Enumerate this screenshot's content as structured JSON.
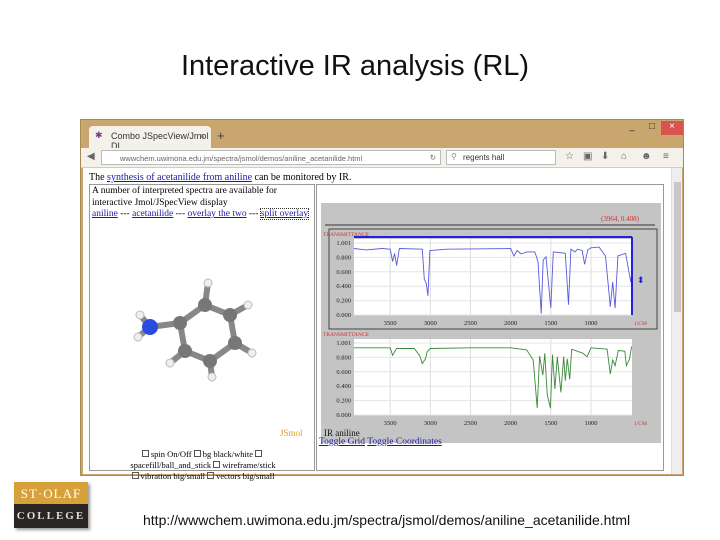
{
  "slide": {
    "title": "Interactive IR analysis (RL)",
    "footer_url": "http://wwwchem.uwimona.edu.jm/spectra/jsmol/demos/aniline_acetanilide.html",
    "logo_top": "ST·OLAF",
    "logo_bottom": "COLLEGE"
  },
  "browser": {
    "tab_title": "Combo JSpecView/Jmol DL...",
    "tab_close": "×",
    "new_tab": "+",
    "url": "wwwchem.uwimona.edu.jm/spectra/jsmol/demos/aniline_acetanilide.html",
    "search_value": "regents hall",
    "win_min": "_",
    "win_max": "□",
    "win_close": "×"
  },
  "page": {
    "intro_pre": "The ",
    "intro_link": "synthesis of acetanilide from aniline",
    "intro_post": " can be monitored by IR.",
    "desc": "A number of interpreted spectra are available for interactive Jmol/JSpecView display",
    "links": [
      "aniline",
      "acetanilide",
      "overlay the two",
      "split overlay"
    ],
    "sep": " --- ",
    "jsmol_label": "JSmol",
    "options": [
      "spin On/Off",
      "bg black/white",
      "spacefill/ball_and_stick",
      "wireframe/stick",
      "vibration big/small",
      "vectors big/small"
    ],
    "toggle_grid": "Toggle Grid",
    "toggle_coords": "Toggle Coordinates",
    "spectrum_title": "IR aniline",
    "coord_readout": "(3964, 0.408)"
  },
  "chart_data": [
    {
      "type": "line",
      "ylabel": "TRANSMITTANCE",
      "xlabel": "1/CM",
      "xlim": [
        3950,
        490
      ],
      "ylim": [
        0,
        1.05
      ],
      "yticks": [
        "1.001",
        "0.800",
        "0.600",
        "0.400",
        "0.200",
        "0.000"
      ],
      "xticks": [
        "3500",
        "3000",
        "2500",
        "2000",
        "1500",
        "1000"
      ],
      "series": [
        {
          "name": "aniline",
          "color": "#5a5ae0",
          "points": [
            [
              3950,
              0.97
            ],
            [
              3800,
              0.95
            ],
            [
              3600,
              0.97
            ],
            [
              3500,
              0.96
            ],
            [
              3470,
              0.78
            ],
            [
              3445,
              0.9
            ],
            [
              3420,
              0.72
            ],
            [
              3385,
              0.97
            ],
            [
              3100,
              0.96
            ],
            [
              3075,
              0.52
            ],
            [
              3050,
              0.46
            ],
            [
              3030,
              0.28
            ],
            [
              3005,
              0.94
            ],
            [
              2800,
              0.96
            ],
            [
              2000,
              0.97
            ],
            [
              1960,
              0.86
            ],
            [
              1920,
              0.94
            ],
            [
              1870,
              0.89
            ],
            [
              1800,
              0.92
            ],
            [
              1700,
              0.92
            ],
            [
              1660,
              0.78
            ],
            [
              1620,
              0.02
            ],
            [
              1595,
              0.8
            ],
            [
              1560,
              0.85
            ],
            [
              1500,
              0.1
            ],
            [
              1470,
              0.92
            ],
            [
              1320,
              0.9
            ],
            [
              1280,
              0.15
            ],
            [
              1250,
              0.96
            ],
            [
              1200,
              0.92
            ],
            [
              1170,
              0.96
            ],
            [
              1110,
              0.94
            ],
            [
              1080,
              0.74
            ],
            [
              1040,
              0.95
            ],
            [
              1000,
              0.98
            ],
            [
              900,
              0.99
            ],
            [
              820,
              0.86
            ],
            [
              760,
              0.12
            ],
            [
              730,
              0.48
            ],
            [
              700,
              0.1
            ],
            [
              665,
              0.86
            ],
            [
              570,
              0.9
            ],
            [
              505,
              0.48
            ],
            [
              495,
              0.6
            ]
          ]
        }
      ]
    },
    {
      "type": "line",
      "ylabel": "TRANSMITTANCE",
      "xlabel": "1/CM",
      "xlim": [
        3950,
        490
      ],
      "ylim": [
        0,
        1.05
      ],
      "yticks": [
        "1.001",
        "0.800",
        "0.600",
        "0.400",
        "0.200",
        "0.000"
      ],
      "xticks": [
        "3500",
        "3000",
        "2500",
        "2000",
        "1500",
        "1000"
      ],
      "series": [
        {
          "name": "acetanilide",
          "color": "#3a8a3a",
          "points": [
            [
              3950,
              0.98
            ],
            [
              3500,
              0.98
            ],
            [
              3470,
              0.87
            ],
            [
              3420,
              0.97
            ],
            [
              3200,
              0.97
            ],
            [
              3130,
              0.86
            ],
            [
              3100,
              0.75
            ],
            [
              3060,
              0.82
            ],
            [
              3040,
              0.92
            ],
            [
              3000,
              0.97
            ],
            [
              2500,
              0.98
            ],
            [
              2000,
              0.98
            ],
            [
              1800,
              0.95
            ],
            [
              1720,
              0.8
            ],
            [
              1670,
              0.1
            ],
            [
              1640,
              0.86
            ],
            [
              1600,
              0.58
            ],
            [
              1575,
              0.9
            ],
            [
              1545,
              0.3
            ],
            [
              1505,
              0.1
            ],
            [
              1480,
              0.88
            ],
            [
              1450,
              0.38
            ],
            [
              1420,
              0.85
            ],
            [
              1375,
              0.33
            ],
            [
              1340,
              0.85
            ],
            [
              1320,
              0.5
            ],
            [
              1295,
              0.82
            ],
            [
              1265,
              0.52
            ],
            [
              1240,
              0.96
            ],
            [
              1100,
              0.9
            ],
            [
              1050,
              0.85
            ],
            [
              1000,
              0.98
            ],
            [
              800,
              0.96
            ],
            [
              760,
              0.6
            ],
            [
              730,
              0.8
            ],
            [
              700,
              0.72
            ],
            [
              660,
              0.94
            ],
            [
              580,
              0.93
            ],
            [
              560,
              0.72
            ],
            [
              520,
              0.82
            ],
            [
              495,
              1.0
            ]
          ]
        }
      ]
    }
  ]
}
